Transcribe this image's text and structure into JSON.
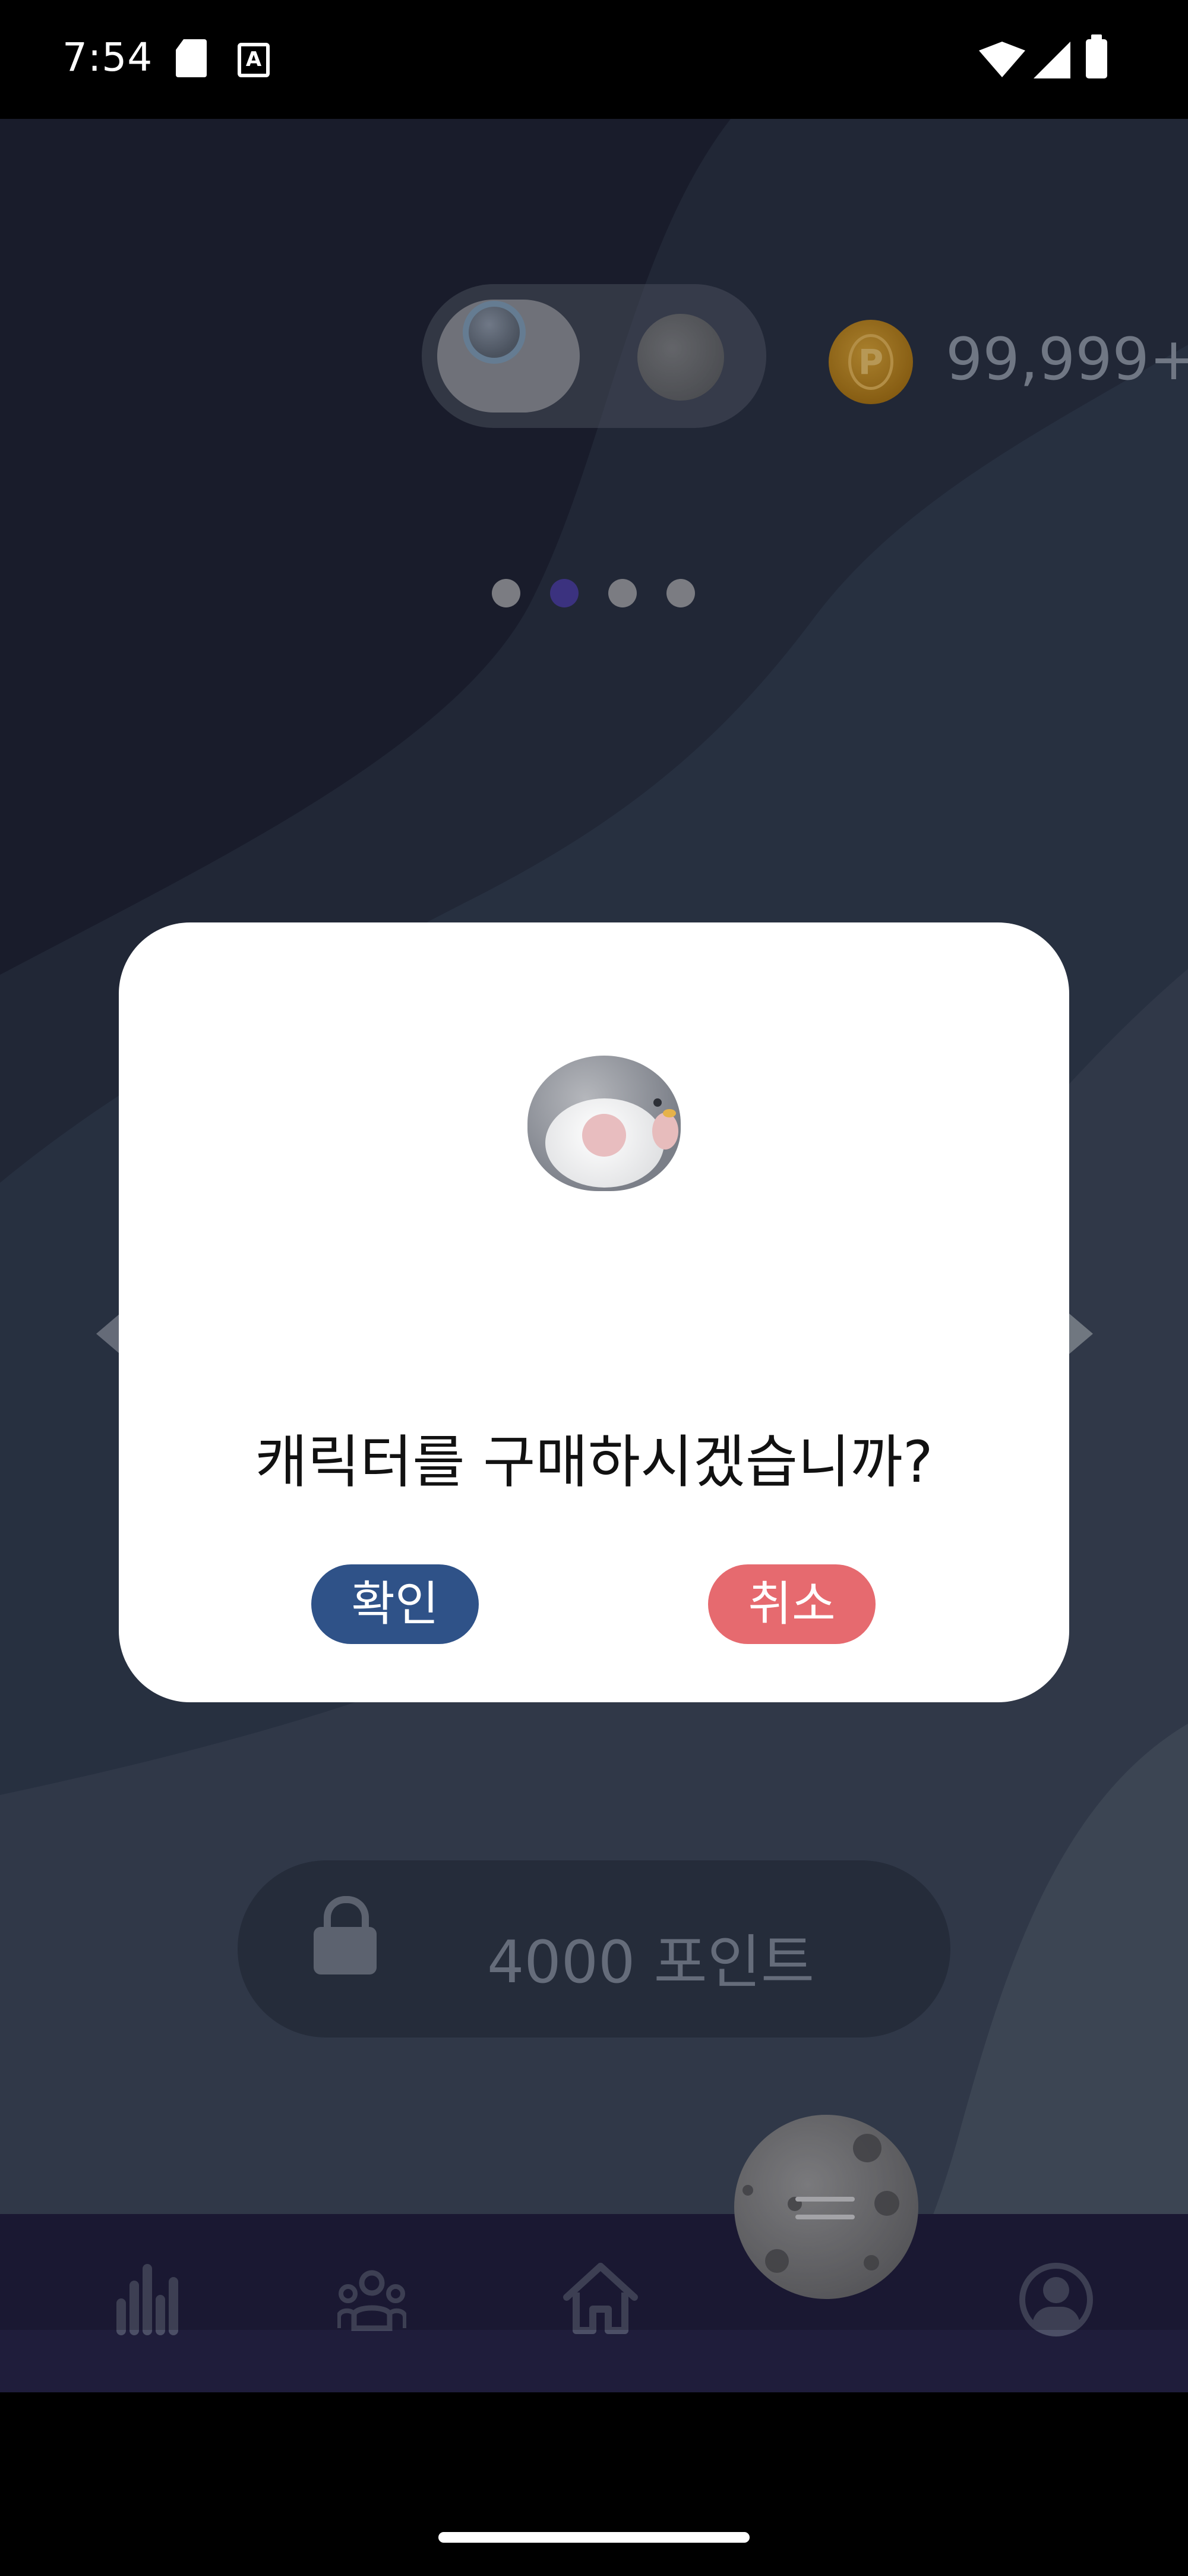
{
  "status_bar": {
    "time": "7:54",
    "left_icons": [
      "sd-card-icon",
      "keyboard-a-icon"
    ],
    "right_icons": [
      "wifi-icon",
      "signal-icon",
      "battery-icon"
    ]
  },
  "header": {
    "character_toggle": {
      "options": [
        "penguin-character",
        "moon-character"
      ],
      "selected": "penguin-character"
    },
    "points": {
      "coin_symbol": "P",
      "balance": "99,999+"
    }
  },
  "carousel": {
    "page_count": 4,
    "active_index": 1
  },
  "purchase": {
    "lock_icon": "lock-icon",
    "price_label": "4000 포인트"
  },
  "dialog": {
    "image": "penguin-character",
    "message": "캐릭터를 구매하시겠습니까?",
    "confirm_label": "확인",
    "cancel_label": "취소",
    "colors": {
      "confirm": "#2f5288",
      "cancel": "#e66a6f"
    }
  },
  "bottom_nav": {
    "items": [
      "stats-icon",
      "friends-icon",
      "home-icon",
      "swap-moon-button",
      "profile-icon"
    ],
    "background": "#1f1d3b"
  }
}
